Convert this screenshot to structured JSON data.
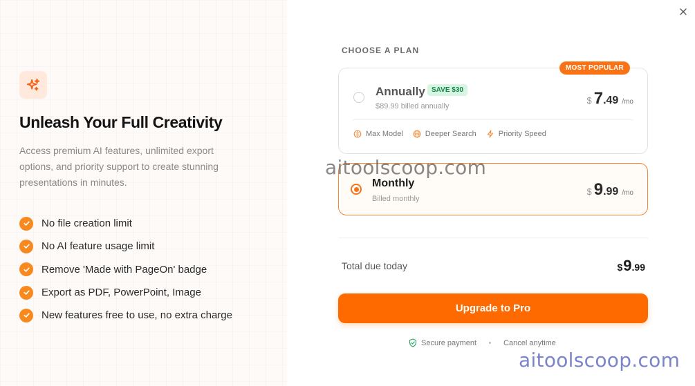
{
  "colors": {
    "accent": "#ff6a00",
    "check": "#f7891f",
    "save_badge_bg": "#d6f5e2",
    "save_badge_text": "#17864b"
  },
  "left": {
    "icon": "sparkles-icon",
    "headline": "Unleash Your Full Creativity",
    "description": "Access premium AI features, unlimited export options, and priority support to create stunning presentations in minutes.",
    "features": [
      "No file creation limit",
      "No AI feature usage limit",
      "Remove 'Made with PageOn' badge",
      "Export as PDF, PowerPoint, Image",
      "New features free to use, no extra charge"
    ]
  },
  "choose_label": "CHOOSE A PLAN",
  "plans": {
    "annual": {
      "badge": "MOST POPULAR",
      "name": "Annually",
      "save": "SAVE $30",
      "sub": "$89.99 billed annually",
      "currency": "$",
      "price_int": "7",
      "price_dec": ".49",
      "per": "/mo",
      "selected": false,
      "perks": [
        "Max Model",
        "Deeper Search",
        "Priority Speed"
      ]
    },
    "monthly": {
      "name": "Monthly",
      "sub": "Billed monthly",
      "currency": "$",
      "price_int": "9",
      "price_dec": ".99",
      "per": "/mo",
      "selected": true
    }
  },
  "total": {
    "label": "Total due today",
    "currency": "$",
    "int": "9",
    "dec": ".99"
  },
  "cta": "Upgrade to Pro",
  "footer": {
    "secure": "Secure payment",
    "cancel": "Cancel anytime"
  },
  "watermark": "aitoolscoop.com"
}
